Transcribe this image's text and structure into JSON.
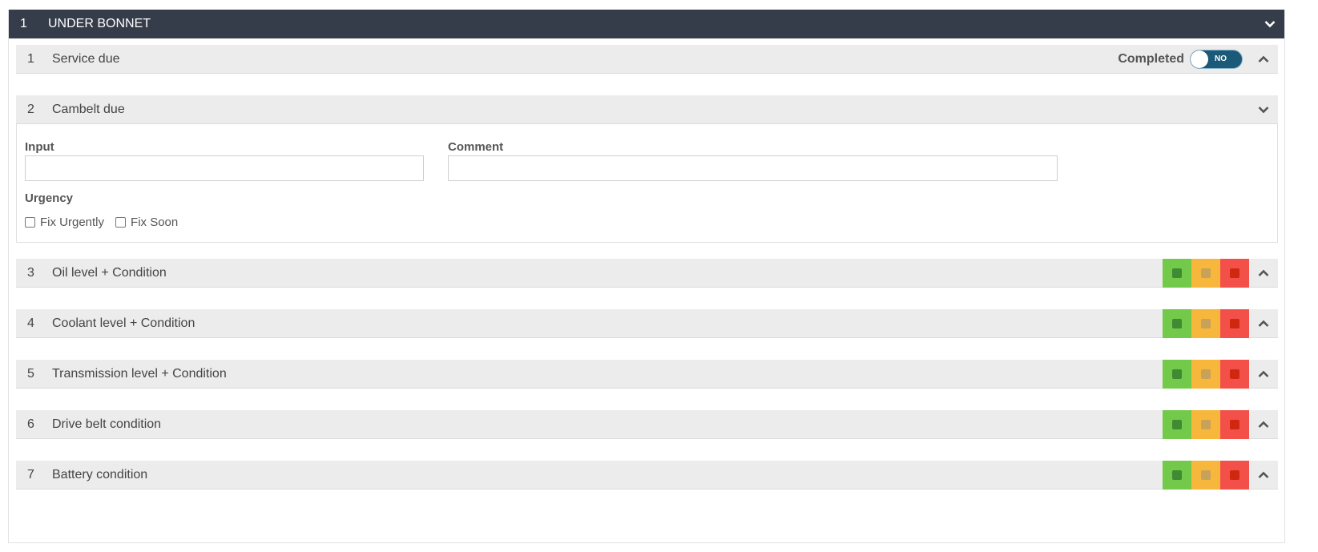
{
  "section": {
    "number": "1",
    "title": "UNDER BONNET"
  },
  "items": [
    {
      "number": "1",
      "label": "Service due",
      "completed_label": "Completed",
      "toggle_text": "NO"
    },
    {
      "number": "2",
      "label": "Cambelt due"
    },
    {
      "number": "3",
      "label": "Oil level + Condition"
    },
    {
      "number": "4",
      "label": "Coolant level + Condition"
    },
    {
      "number": "5",
      "label": "Transmission level + Condition"
    },
    {
      "number": "6",
      "label": "Drive belt condition"
    },
    {
      "number": "7",
      "label": "Battery condition"
    }
  ],
  "form": {
    "input_label": "Input",
    "input_value": "",
    "comment_label": "Comment",
    "comment_value": "",
    "urgency_label": "Urgency",
    "options": [
      "Fix Urgently",
      "Fix Soon"
    ]
  },
  "colors": {
    "header_bg": "#363d4a",
    "green": "#73c94a",
    "green_dot": "#3f8a33",
    "amber": "#f6b73c",
    "amber_dot": "#c9a25a",
    "red": "#f4504a",
    "red_dot": "#d02810",
    "toggle_bg": "#1a5a78"
  },
  "icons": {
    "collapse": "chevron-up-icon",
    "expand": "chevron-down-icon",
    "rag_square": "square-icon"
  }
}
